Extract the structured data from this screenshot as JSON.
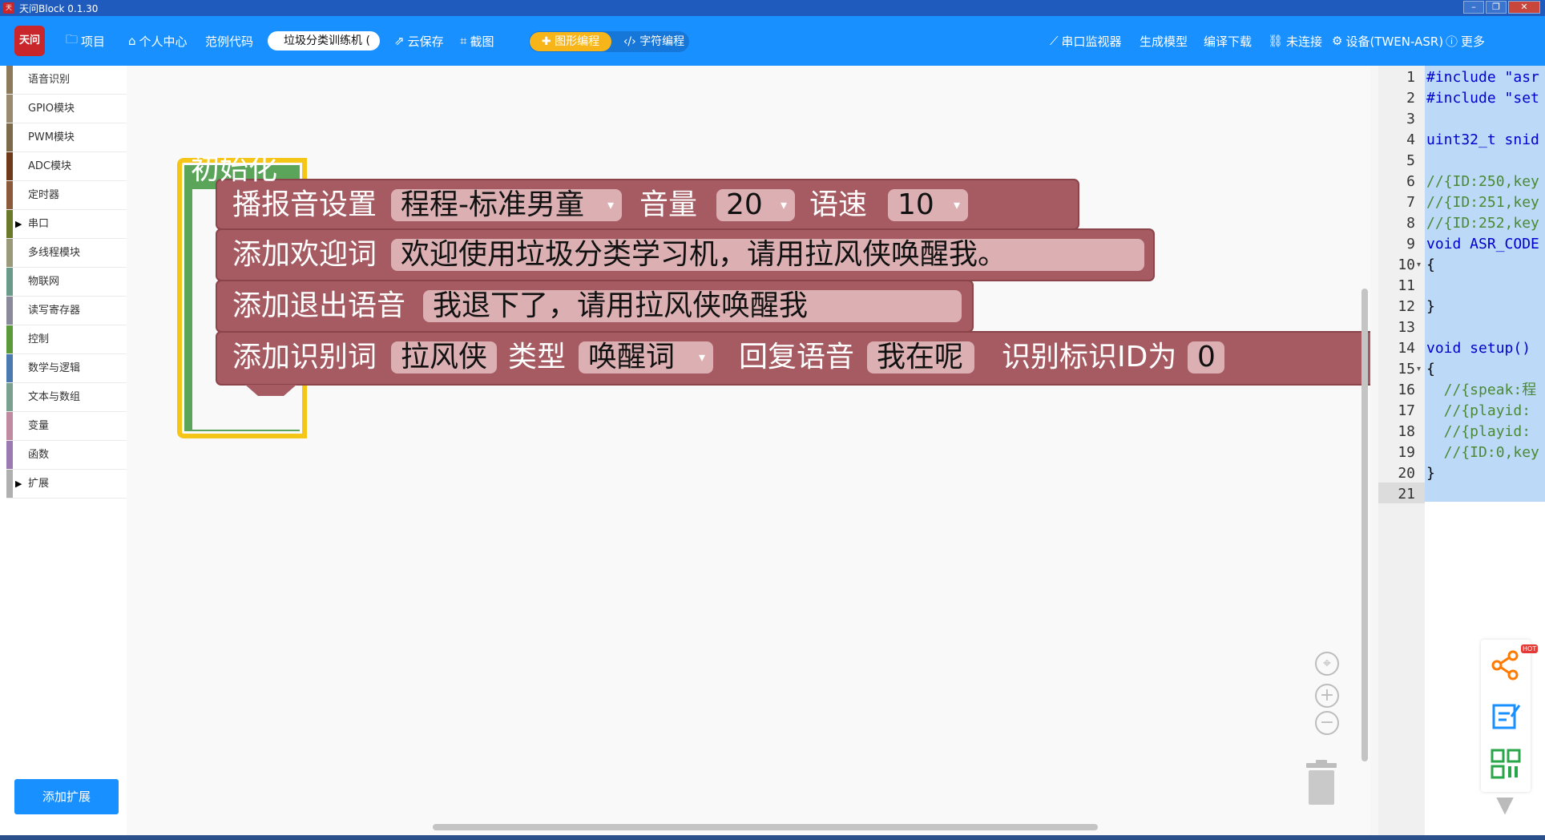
{
  "window": {
    "title": "天问Block 0.1.30",
    "controls": {
      "minimize": "–",
      "maximize": "❐",
      "close": "✕"
    }
  },
  "toolbar": {
    "logo_text": "天问",
    "project_label": "项目",
    "personal_center": "个人中心",
    "example_code": "范例代码",
    "project_name": "垃圾分类训练机 (",
    "cloud_save": "云保存",
    "screenshot": "截图",
    "graphic_mode": "图形编程",
    "text_mode": "字符编程",
    "serial_monitor": "串口监视器",
    "generate_model": "生成模型",
    "compile_download": "编译下载",
    "connection_status": "未连接",
    "device": "设备(TWEN-ASR)",
    "more": "更多",
    "icons": {
      "project": "folder-icon",
      "personal": "home-icon",
      "cloud_save": "share-icon",
      "screenshot": "crop-icon",
      "graphic": "puzzle-icon",
      "text": "code-icon",
      "serial": "chart-icon",
      "connection": "link-icon",
      "device": "gear-icon",
      "more": "help-icon"
    }
  },
  "sidebar": {
    "categories": [
      {
        "label": "语音识别",
        "color": "#8d7a5a",
        "expandable": false
      },
      {
        "label": "GPIO模块",
        "color": "#9a8a70",
        "expandable": false
      },
      {
        "label": "PWM模块",
        "color": "#7d6a4a",
        "expandable": false
      },
      {
        "label": "ADC模块",
        "color": "#6e3a1a",
        "expandable": false
      },
      {
        "label": "定时器",
        "color": "#8a5a3a",
        "expandable": false
      },
      {
        "label": "串口",
        "color": "#6a7a2a",
        "expandable": true
      },
      {
        "label": "多线程模块",
        "color": "#9a9a7a",
        "expandable": false
      },
      {
        "label": "物联网",
        "color": "#6a9a8a",
        "expandable": false
      },
      {
        "label": "读写寄存器",
        "color": "#8a8a9a",
        "expandable": false
      },
      {
        "label": "控制",
        "color": "#5a9a3a",
        "expandable": false
      },
      {
        "label": "数学与逻辑",
        "color": "#4a7ab0",
        "expandable": false
      },
      {
        "label": "文本与数组",
        "color": "#7aa090",
        "expandable": false
      },
      {
        "label": "变量",
        "color": "#c08aa0",
        "expandable": false
      },
      {
        "label": "函数",
        "color": "#9a7ab0",
        "expandable": false
      },
      {
        "label": "扩展",
        "color": "#b0b0b0",
        "expandable": true
      }
    ],
    "add_extension": "添加扩展"
  },
  "workspace": {
    "init_block": {
      "label": "初始化",
      "color": "#5ba55b",
      "highlight": "#f5c518"
    },
    "blocks": [
      {
        "label": "播报音设置",
        "voice": "程程-标准男童",
        "volume_label": "音量",
        "volume": "20",
        "speed_label": "语速",
        "speed": "10"
      },
      {
        "label": "添加欢迎词",
        "text": "欢迎使用垃圾分类学习机，请用拉风侠唤醒我。"
      },
      {
        "label": "添加退出语音",
        "text": "我退下了，请用拉风侠唤醒我"
      },
      {
        "label": "添加识别词",
        "word": "拉风侠",
        "type_label": "类型",
        "type": "唤醒词",
        "reply_label": "回复语音",
        "reply": "我在呢",
        "id_label": "识别标识ID为",
        "id": "0"
      }
    ],
    "block_color": "#a55b61",
    "dropdown_arrow": "▾",
    "controls": {
      "center": "⌖",
      "zoom_in": "+",
      "zoom_out": "−"
    }
  },
  "editor": {
    "line_numbers": [
      "1",
      "2",
      "3",
      "4",
      "5",
      "6",
      "7",
      "8",
      "9",
      "10",
      "11",
      "12",
      "13",
      "14",
      "15",
      "16",
      "17",
      "18",
      "19",
      "20",
      "21"
    ],
    "lines": [
      "#include \"asr",
      "#include \"set",
      "",
      "uint32_t snid",
      "",
      "//{ID:250,key",
      "//{ID:251,key",
      "//{ID:252,key",
      "void ASR_CODE",
      "{",
      "",
      "}",
      "",
      "void setup()",
      "{",
      "  //{speak:程",
      "  //{playid:",
      "  //{playid:",
      "  //{ID:0,key",
      "}",
      ""
    ],
    "fold_lines": [
      10,
      15
    ]
  },
  "float_panel": {
    "hot_badge": "HOT",
    "items": [
      "share-icon",
      "edit-icon",
      "qrcode-icon"
    ]
  }
}
